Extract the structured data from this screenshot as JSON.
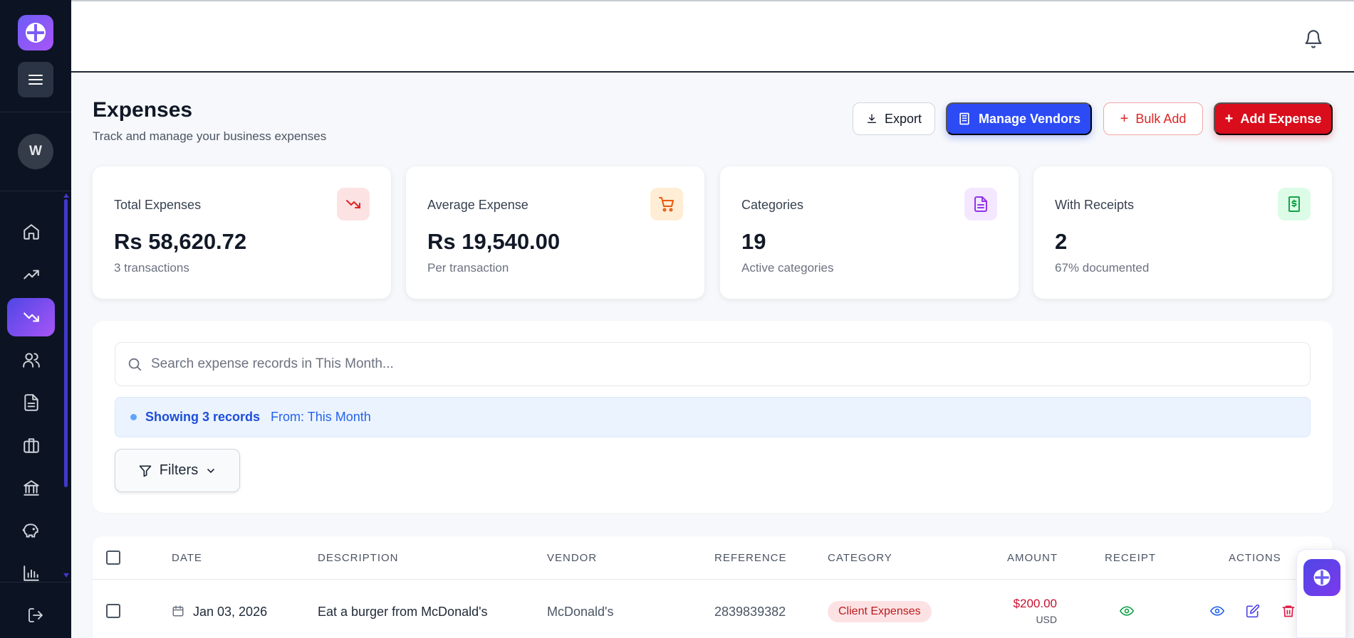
{
  "sidebar": {
    "avatar_initial": "W",
    "active_index": 2,
    "items": [
      {
        "icon": "home-icon"
      },
      {
        "icon": "trending-up-icon"
      },
      {
        "icon": "trending-down-icon"
      },
      {
        "icon": "users-icon"
      },
      {
        "icon": "document-icon"
      },
      {
        "icon": "briefcase-icon"
      },
      {
        "icon": "bank-icon"
      },
      {
        "icon": "piggy-bank-icon"
      },
      {
        "icon": "bar-chart-icon"
      }
    ]
  },
  "page": {
    "title": "Expenses",
    "subtitle": "Track and manage your business expenses"
  },
  "toolbar": {
    "export_label": "Export",
    "vendors_label": "Manage Vendors",
    "bulk_label": "Bulk Add",
    "add_label": "Add Expense"
  },
  "stats": [
    {
      "label": "Total Expenses",
      "value": "Rs 58,620.72",
      "sub": "3 transactions",
      "icon": "trending-down-icon",
      "color": "#dc2626",
      "bg": "#fde2e4"
    },
    {
      "label": "Average Expense",
      "value": "Rs 19,540.00",
      "sub": "Per transaction",
      "icon": "cart-icon",
      "color": "#ea580c",
      "bg": "#ffedd5"
    },
    {
      "label": "Categories",
      "value": "19",
      "sub": "Active categories",
      "icon": "file-text-icon",
      "color": "#9333ea",
      "bg": "#f3e8ff"
    },
    {
      "label": "With Receipts",
      "value": "2",
      "sub": "67% documented",
      "icon": "receipt-dollar-icon",
      "color": "#16a34a",
      "bg": "#dcfce7"
    }
  ],
  "search": {
    "placeholder": "Search expense records in This Month...",
    "value": ""
  },
  "info": {
    "count": "Showing 3 records",
    "from": "From: This Month"
  },
  "filters": {
    "label": "Filters"
  },
  "table": {
    "headers": {
      "date": "DATE",
      "description": "DESCRIPTION",
      "vendor": "VENDOR",
      "reference": "REFERENCE",
      "category": "CATEGORY",
      "amount": "AMOUNT",
      "receipt": "RECEIPT",
      "actions": "ACTIONS"
    },
    "rows": [
      {
        "date": "Jan 03, 2026",
        "description": "Eat a burger from McDonald's",
        "vendor": "McDonald's",
        "reference": "2839839382",
        "category": "Client Expenses",
        "amount": "$200.00",
        "currency": "USD"
      }
    ]
  },
  "colors": {
    "accent": "#2c4bf5",
    "danger": "#d90d1b",
    "sidebar_bg": "#0c1424"
  }
}
